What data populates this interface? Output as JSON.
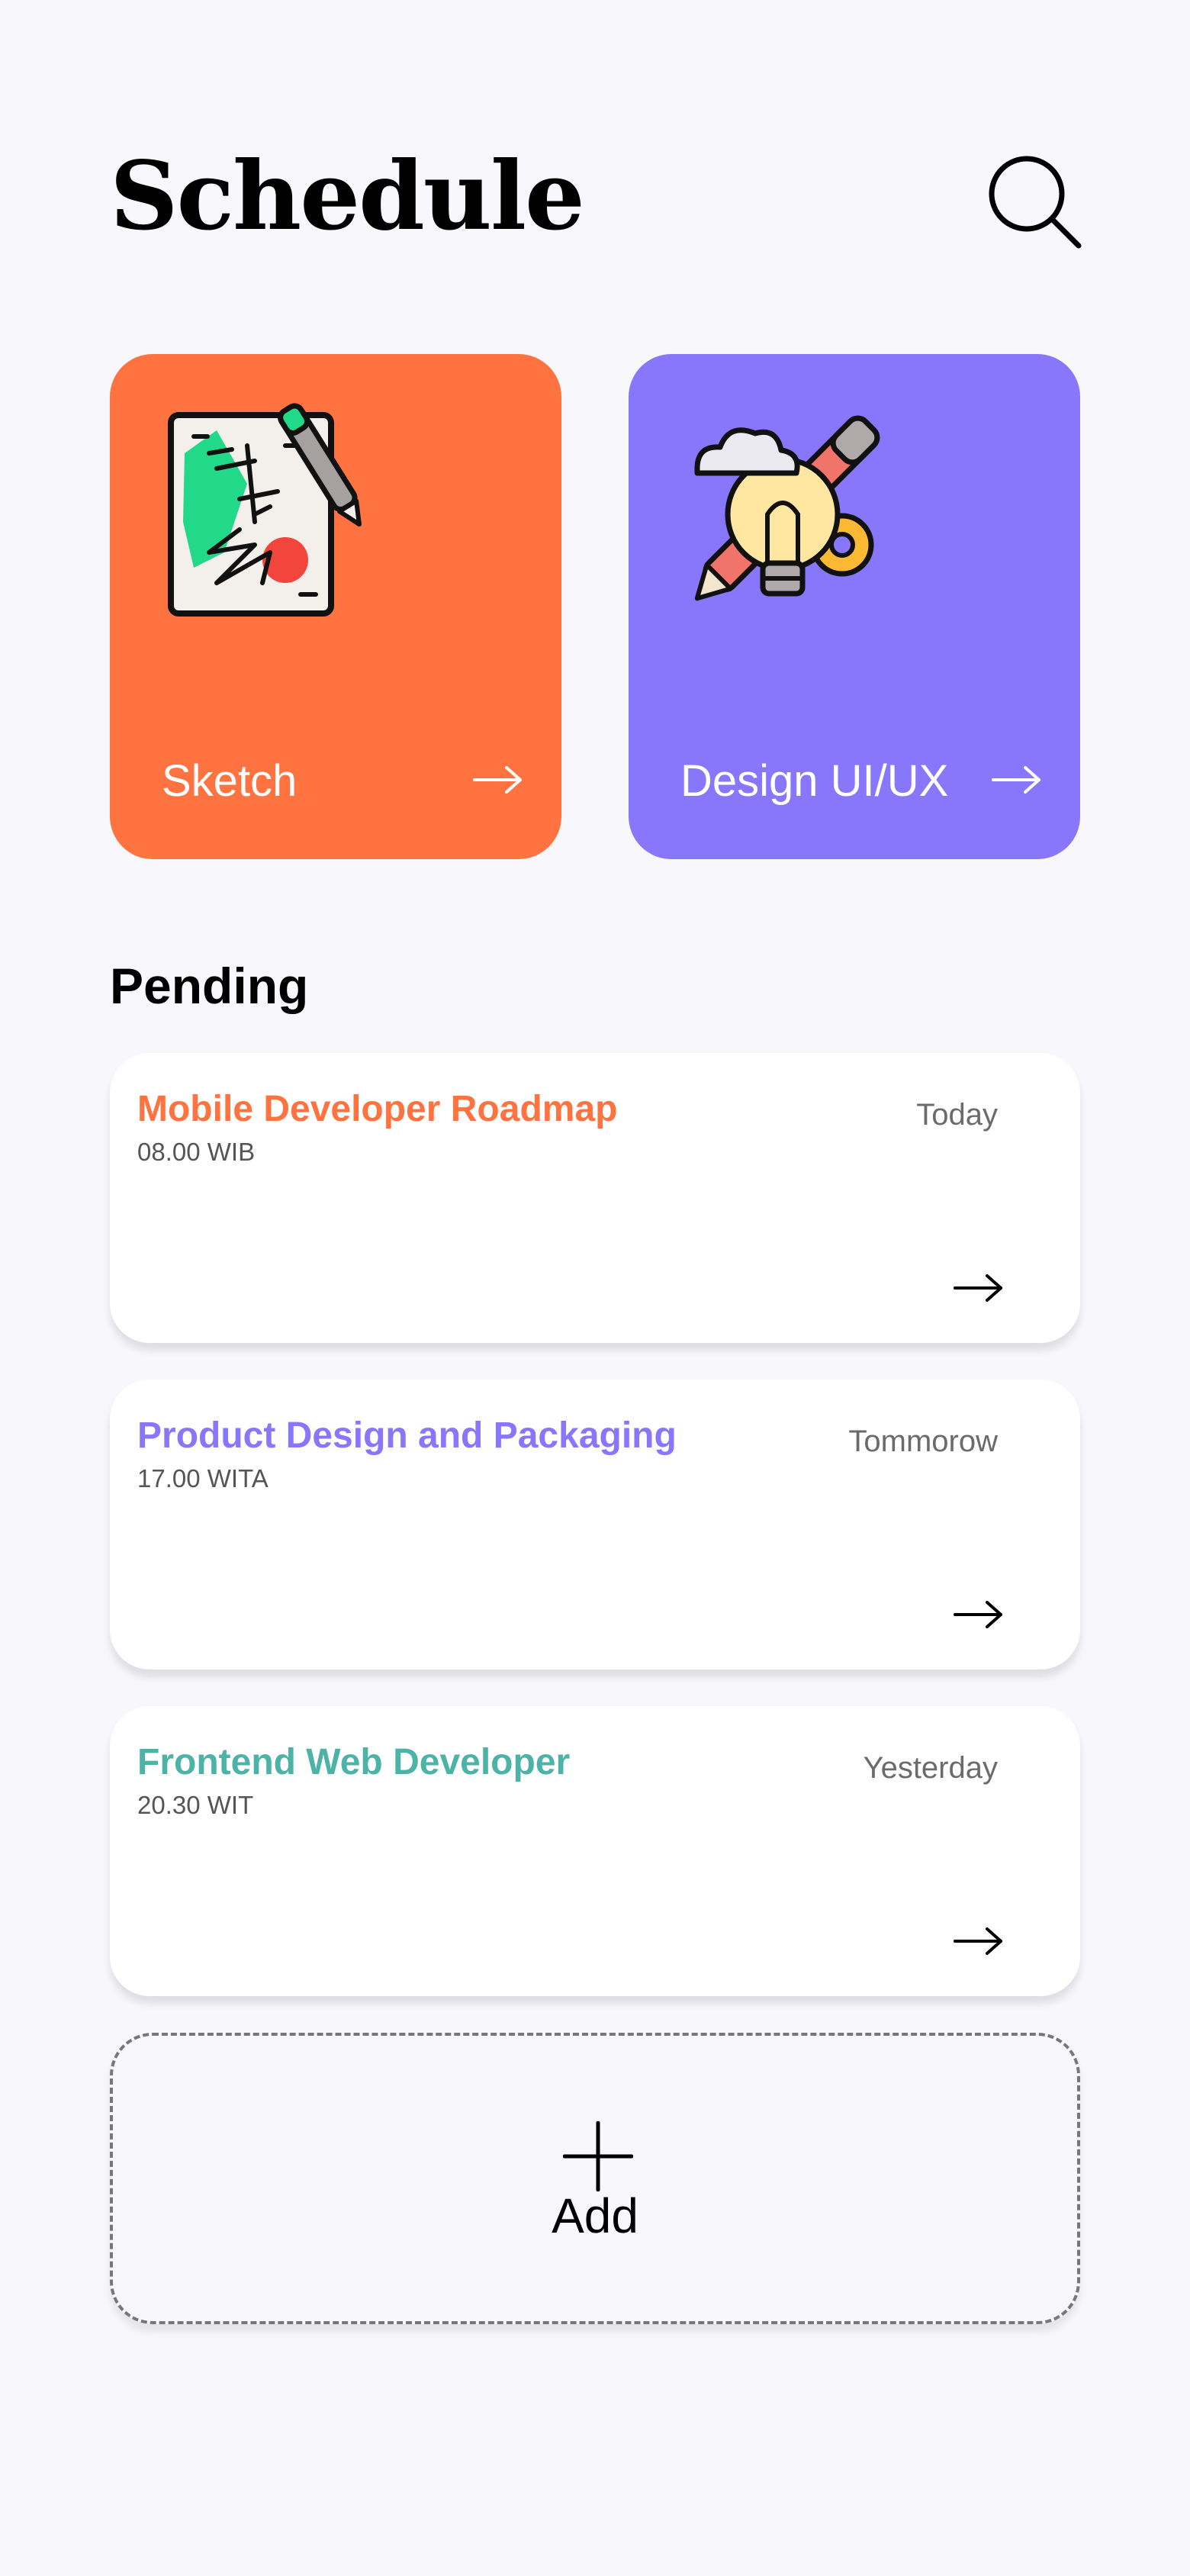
{
  "header": {
    "title": "Schedule"
  },
  "categories": [
    {
      "label": "Sketch",
      "color": "#FF7340",
      "icon": "sketch-pad-icon"
    },
    {
      "label": "Design UI/UX",
      "color": "#8876FB",
      "icon": "design-lightbulb-icon"
    }
  ],
  "pending": {
    "title": "Pending",
    "tasks": [
      {
        "name": "Mobile Developer Roadmap",
        "time": "08.00 WIB",
        "day": "Today",
        "color": "#FF7340"
      },
      {
        "name": "Product Design and Packaging",
        "time": "17.00 WITA",
        "day": "Tommorow",
        "color": "#8876FB"
      },
      {
        "name": "Frontend Web Developer",
        "time": "20.30 WIT",
        "day": "Yesterday",
        "color": "#4DB3A6"
      }
    ]
  },
  "add": {
    "label": "Add"
  }
}
